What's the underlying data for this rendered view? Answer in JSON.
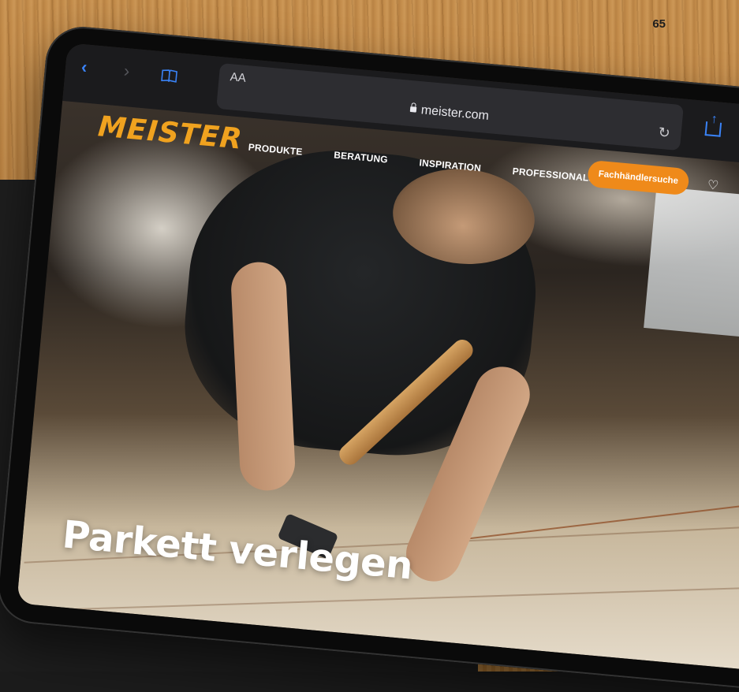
{
  "page": {
    "number": "65"
  },
  "browser": {
    "text_size_label": "AA",
    "url": "meister.com",
    "icons": {
      "back": "chevron-left-icon",
      "forward": "chevron-right-icon",
      "bookmarks": "book-icon",
      "reload": "reload-icon",
      "share": "share-icon",
      "lock": "lock-icon"
    }
  },
  "site": {
    "logo": "MEISTER",
    "nav": [
      "PRODUKTE",
      "BERATUNG",
      "INSPIRATION",
      "PROFESSIONALS"
    ],
    "dealer_button": "Fachhändlersuche",
    "wishlist_icon": "heart-icon",
    "headline": "Parkett verlegen"
  },
  "colors": {
    "brand_orange": "#ef8a1a",
    "logo_orange": "#f0a21f",
    "safari_blue": "#3a83f7"
  }
}
